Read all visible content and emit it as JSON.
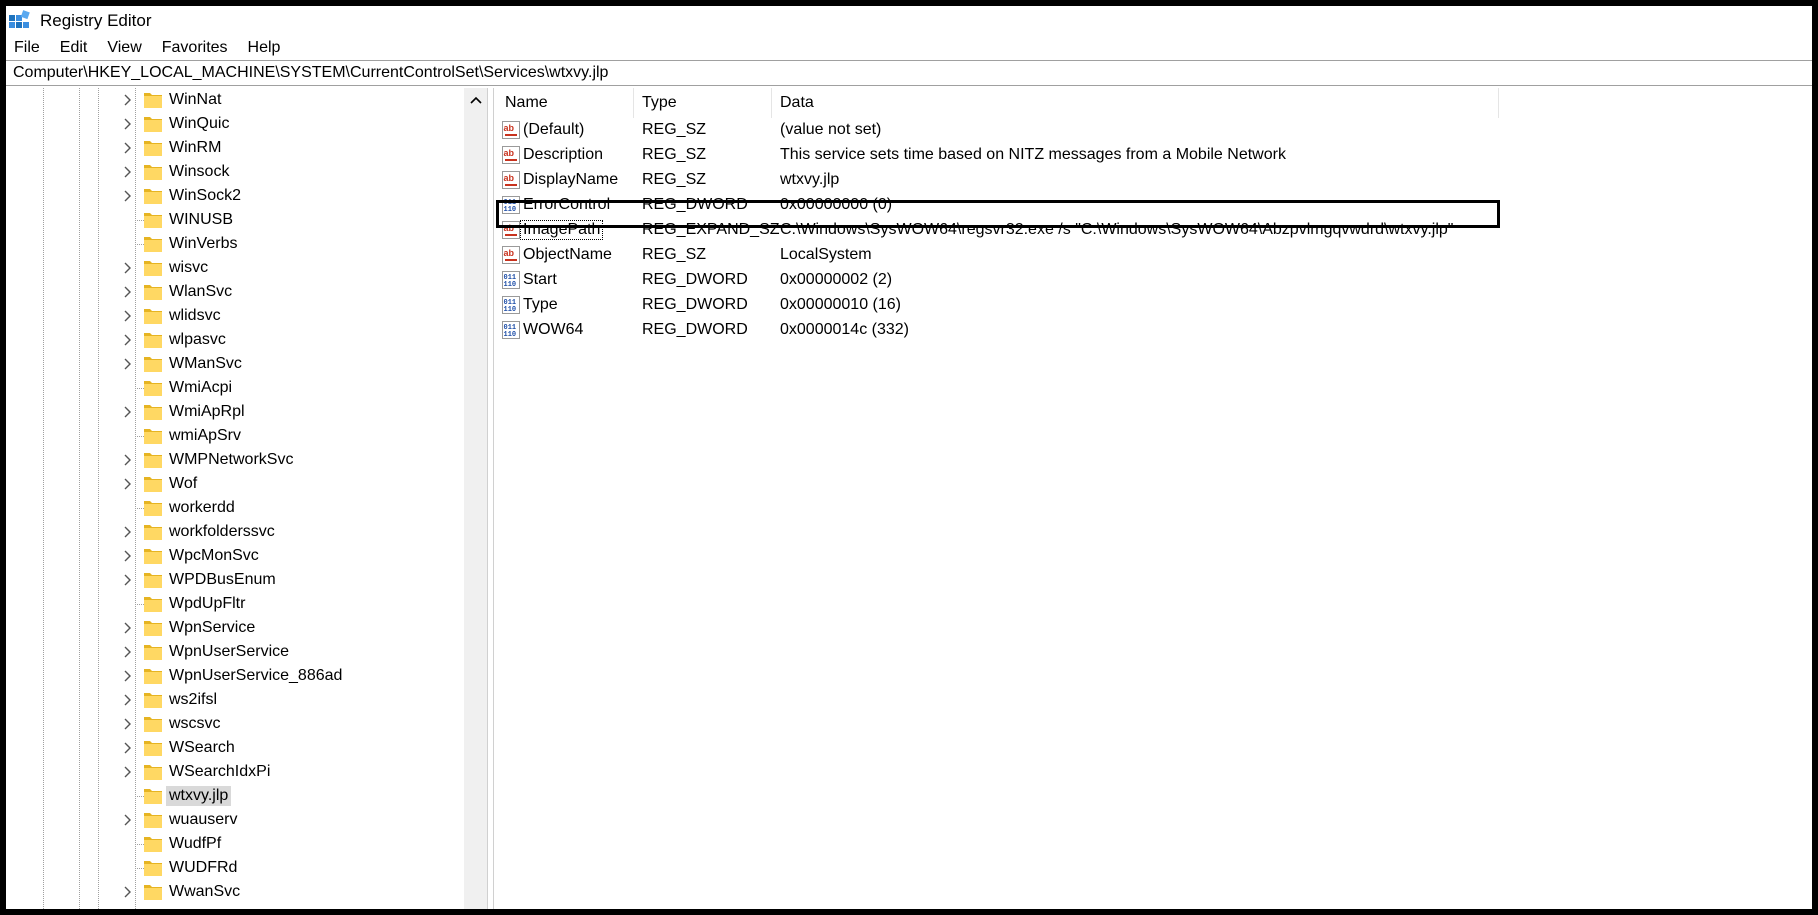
{
  "window": {
    "title": "Registry Editor",
    "icon": "registry-editor-icon"
  },
  "menu": {
    "items": [
      "File",
      "Edit",
      "View",
      "Favorites",
      "Help"
    ]
  },
  "address": {
    "path": "Computer\\HKEY_LOCAL_MACHINE\\SYSTEM\\CurrentControlSet\\Services\\wtxvy.jlp"
  },
  "tree": {
    "items": [
      {
        "label": "WinNat",
        "expandable": true
      },
      {
        "label": "WinQuic",
        "expandable": true
      },
      {
        "label": "WinRM",
        "expandable": true
      },
      {
        "label": "Winsock",
        "expandable": true
      },
      {
        "label": "WinSock2",
        "expandable": true
      },
      {
        "label": "WINUSB",
        "expandable": false
      },
      {
        "label": "WinVerbs",
        "expandable": false
      },
      {
        "label": "wisvc",
        "expandable": true
      },
      {
        "label": "WlanSvc",
        "expandable": true
      },
      {
        "label": "wlidsvc",
        "expandable": true
      },
      {
        "label": "wlpasvc",
        "expandable": true
      },
      {
        "label": "WManSvc",
        "expandable": true
      },
      {
        "label": "WmiAcpi",
        "expandable": false
      },
      {
        "label": "WmiApRpl",
        "expandable": true
      },
      {
        "label": "wmiApSrv",
        "expandable": false
      },
      {
        "label": "WMPNetworkSvc",
        "expandable": true
      },
      {
        "label": "Wof",
        "expandable": true
      },
      {
        "label": "workerdd",
        "expandable": false
      },
      {
        "label": "workfolderssvc",
        "expandable": true
      },
      {
        "label": "WpcMonSvc",
        "expandable": true
      },
      {
        "label": "WPDBusEnum",
        "expandable": true
      },
      {
        "label": "WpdUpFltr",
        "expandable": false
      },
      {
        "label": "WpnService",
        "expandable": true
      },
      {
        "label": "WpnUserService",
        "expandable": true
      },
      {
        "label": "WpnUserService_886ad",
        "expandable": true
      },
      {
        "label": "ws2ifsl",
        "expandable": true
      },
      {
        "label": "wscsvc",
        "expandable": true
      },
      {
        "label": "WSearch",
        "expandable": true
      },
      {
        "label": "WSearchIdxPi",
        "expandable": true
      },
      {
        "label": "wtxvy.jlp",
        "expandable": false,
        "selected": true
      },
      {
        "label": "wuauserv",
        "expandable": true
      },
      {
        "label": "WudfPf",
        "expandable": false
      },
      {
        "label": "WUDFRd",
        "expandable": false
      },
      {
        "label": "WwanSvc",
        "expandable": true
      }
    ]
  },
  "values": {
    "columns": {
      "name": "Name",
      "type": "Type",
      "data": "Data"
    },
    "rows": [
      {
        "name": "(Default)",
        "type": "REG_SZ",
        "data": "(value not set)",
        "icon": "string-value-icon"
      },
      {
        "name": "Description",
        "type": "REG_SZ",
        "data": "This service sets time based on NITZ messages from a Mobile Network",
        "icon": "string-value-icon"
      },
      {
        "name": "DisplayName",
        "type": "REG_SZ",
        "data": "wtxvy.jlp",
        "icon": "string-value-icon"
      },
      {
        "name": "ErrorControl",
        "type": "REG_DWORD",
        "data": "0x00000000 (0)",
        "icon": "binary-value-icon"
      },
      {
        "name": "ImagePath",
        "type": "REG_EXPAND_SZ",
        "data": "C:\\Windows\\SysWOW64\\regsvr32.exe /s \"C:\\Windows\\SysWOW64\\Abzpvlmgqvwdrd\\wtxvy.jlp\"",
        "icon": "string-value-icon"
      },
      {
        "name": "ObjectName",
        "type": "REG_SZ",
        "data": "LocalSystem",
        "icon": "string-value-icon"
      },
      {
        "name": "Start",
        "type": "REG_DWORD",
        "data": "0x00000002 (2)",
        "icon": "binary-value-icon"
      },
      {
        "name": "Type",
        "type": "REG_DWORD",
        "data": "0x00000010 (16)",
        "icon": "binary-value-icon"
      },
      {
        "name": "WOW64",
        "type": "REG_DWORD",
        "data": "0x0000014c (332)",
        "icon": "binary-value-icon"
      }
    ]
  },
  "colors": {
    "folder": "#ffd863",
    "folder_dark": "#e6b422",
    "string_icon_red": "#c8321e",
    "binary_icon_blue": "#1f4fa8"
  }
}
